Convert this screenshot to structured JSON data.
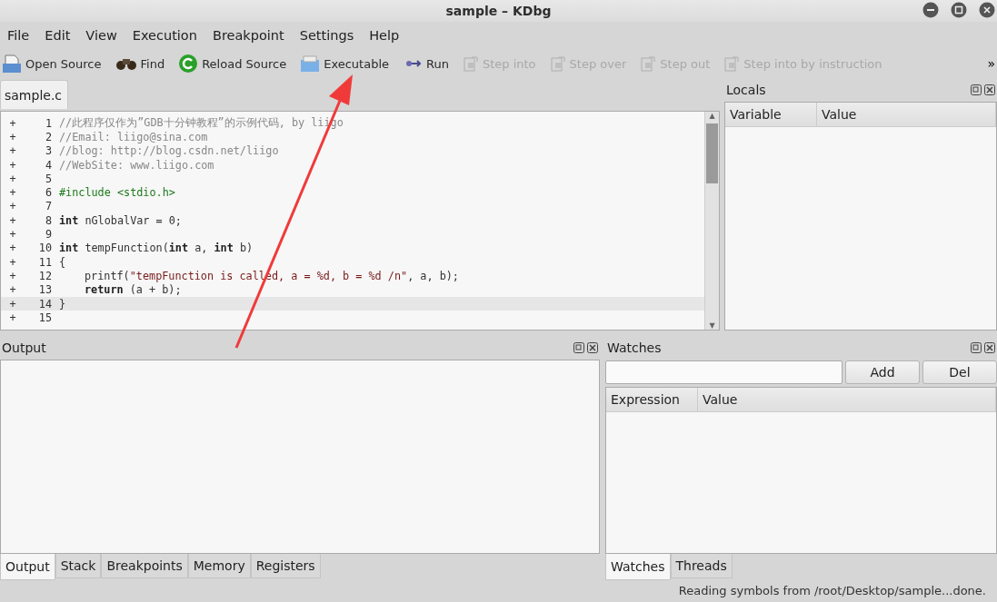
{
  "window": {
    "title": "sample – KDbg"
  },
  "menu": [
    {
      "label": "File"
    },
    {
      "label": "Edit"
    },
    {
      "label": "View"
    },
    {
      "label": "Execution"
    },
    {
      "label": "Breakpoint"
    },
    {
      "label": "Settings"
    },
    {
      "label": "Help"
    }
  ],
  "toolbar": [
    {
      "label": "Open Source",
      "kind": "open",
      "disabled": false
    },
    {
      "label": "Find",
      "kind": "find",
      "disabled": false
    },
    {
      "label": "Reload Source",
      "kind": "reload",
      "disabled": false
    },
    {
      "label": "Executable",
      "kind": "exec",
      "disabled": false
    },
    {
      "label": "Run",
      "kind": "run",
      "disabled": false
    },
    {
      "label": "Step into",
      "kind": "step",
      "disabled": true
    },
    {
      "label": "Step over",
      "kind": "step",
      "disabled": true
    },
    {
      "label": "Step out",
      "kind": "step",
      "disabled": true
    },
    {
      "label": "Step into by instruction",
      "kind": "step",
      "disabled": true
    }
  ],
  "toolbar_overflow": "»",
  "editor": {
    "tabs": [
      {
        "label": "sample.c",
        "selected": true
      }
    ],
    "lines": [
      {
        "marker": "+",
        "number": "1",
        "current": false,
        "tokens": [
          {
            "kind": "comment",
            "text": "//此程序仅作为”GDB十分钟教程”的示例代码, by liigo"
          }
        ]
      },
      {
        "marker": "+",
        "number": "2",
        "current": false,
        "tokens": [
          {
            "kind": "comment",
            "text": "//Email: liigo@sina.com"
          }
        ]
      },
      {
        "marker": "+",
        "number": "3",
        "current": false,
        "tokens": [
          {
            "kind": "comment",
            "text": "//blog: http://blog.csdn.net/liigo"
          }
        ]
      },
      {
        "marker": "+",
        "number": "4",
        "current": false,
        "tokens": [
          {
            "kind": "comment",
            "text": "//WebSite: www.liigo.com"
          }
        ]
      },
      {
        "marker": "+",
        "number": "5",
        "current": false
      },
      {
        "marker": "+",
        "number": "6",
        "current": false,
        "tokens": [
          {
            "kind": "preproc",
            "text": "#include <stdio.h>"
          }
        ]
      },
      {
        "marker": "+",
        "number": "7",
        "current": false
      },
      {
        "marker": "+",
        "number": "8",
        "current": false,
        "tokens": [
          {
            "kind": "keyword",
            "text": "int"
          },
          {
            "kind": "plain",
            "text": " nGlobalVar = 0;"
          }
        ]
      },
      {
        "marker": "+",
        "number": "9",
        "current": false
      },
      {
        "marker": "+",
        "number": "10",
        "current": false,
        "tokens": [
          {
            "kind": "keyword",
            "text": "int"
          },
          {
            "kind": "plain",
            "text": " tempFunction("
          },
          {
            "kind": "keyword",
            "text": "int"
          },
          {
            "kind": "plain",
            "text": " a, "
          },
          {
            "kind": "keyword",
            "text": "int"
          },
          {
            "kind": "plain",
            "text": " b)"
          }
        ]
      },
      {
        "marker": "+",
        "number": "11",
        "current": false,
        "tokens": [
          {
            "kind": "plain",
            "text": "{"
          }
        ]
      },
      {
        "marker": "+",
        "number": "12",
        "current": false,
        "indented": true,
        "tokens": [
          {
            "kind": "plain",
            "text": "printf("
          },
          {
            "kind": "string",
            "text": "\"tempFunction is called, a = %d, b = %d /n\""
          },
          {
            "kind": "plain",
            "text": ", a, b);"
          }
        ]
      },
      {
        "marker": "+",
        "number": "13",
        "current": false,
        "indented": true,
        "tokens": [
          {
            "kind": "keyword",
            "text": "return"
          },
          {
            "kind": "plain",
            "text": " (a + b);"
          }
        ]
      },
      {
        "marker": "+",
        "number": "14",
        "current": true,
        "tokens": [
          {
            "kind": "plain",
            "text": "}"
          }
        ]
      },
      {
        "marker": "+",
        "number": "15",
        "current": false
      }
    ]
  },
  "editor_scroll": {
    "up": "▲",
    "down": "▼"
  },
  "locals": {
    "title": "Locals",
    "columns": [
      "Variable",
      "Value"
    ]
  },
  "output": {
    "title": "Output"
  },
  "watches": {
    "title": "Watches",
    "buttons": [
      "Add",
      "Del"
    ],
    "columns": [
      "Expression",
      "Value"
    ]
  },
  "bottom_tabs_left": [
    {
      "label": "Output",
      "selected": true
    },
    {
      "label": "Stack",
      "selected": false
    },
    {
      "label": "Breakpoints",
      "selected": false
    },
    {
      "label": "Memory",
      "selected": false
    },
    {
      "label": "Registers",
      "selected": false
    }
  ],
  "bottom_tabs_right": [
    {
      "label": "Watches",
      "selected": true
    },
    {
      "label": "Threads",
      "selected": false
    }
  ],
  "status_bar": "Reading symbols from /root/Desktop/sample...done."
}
